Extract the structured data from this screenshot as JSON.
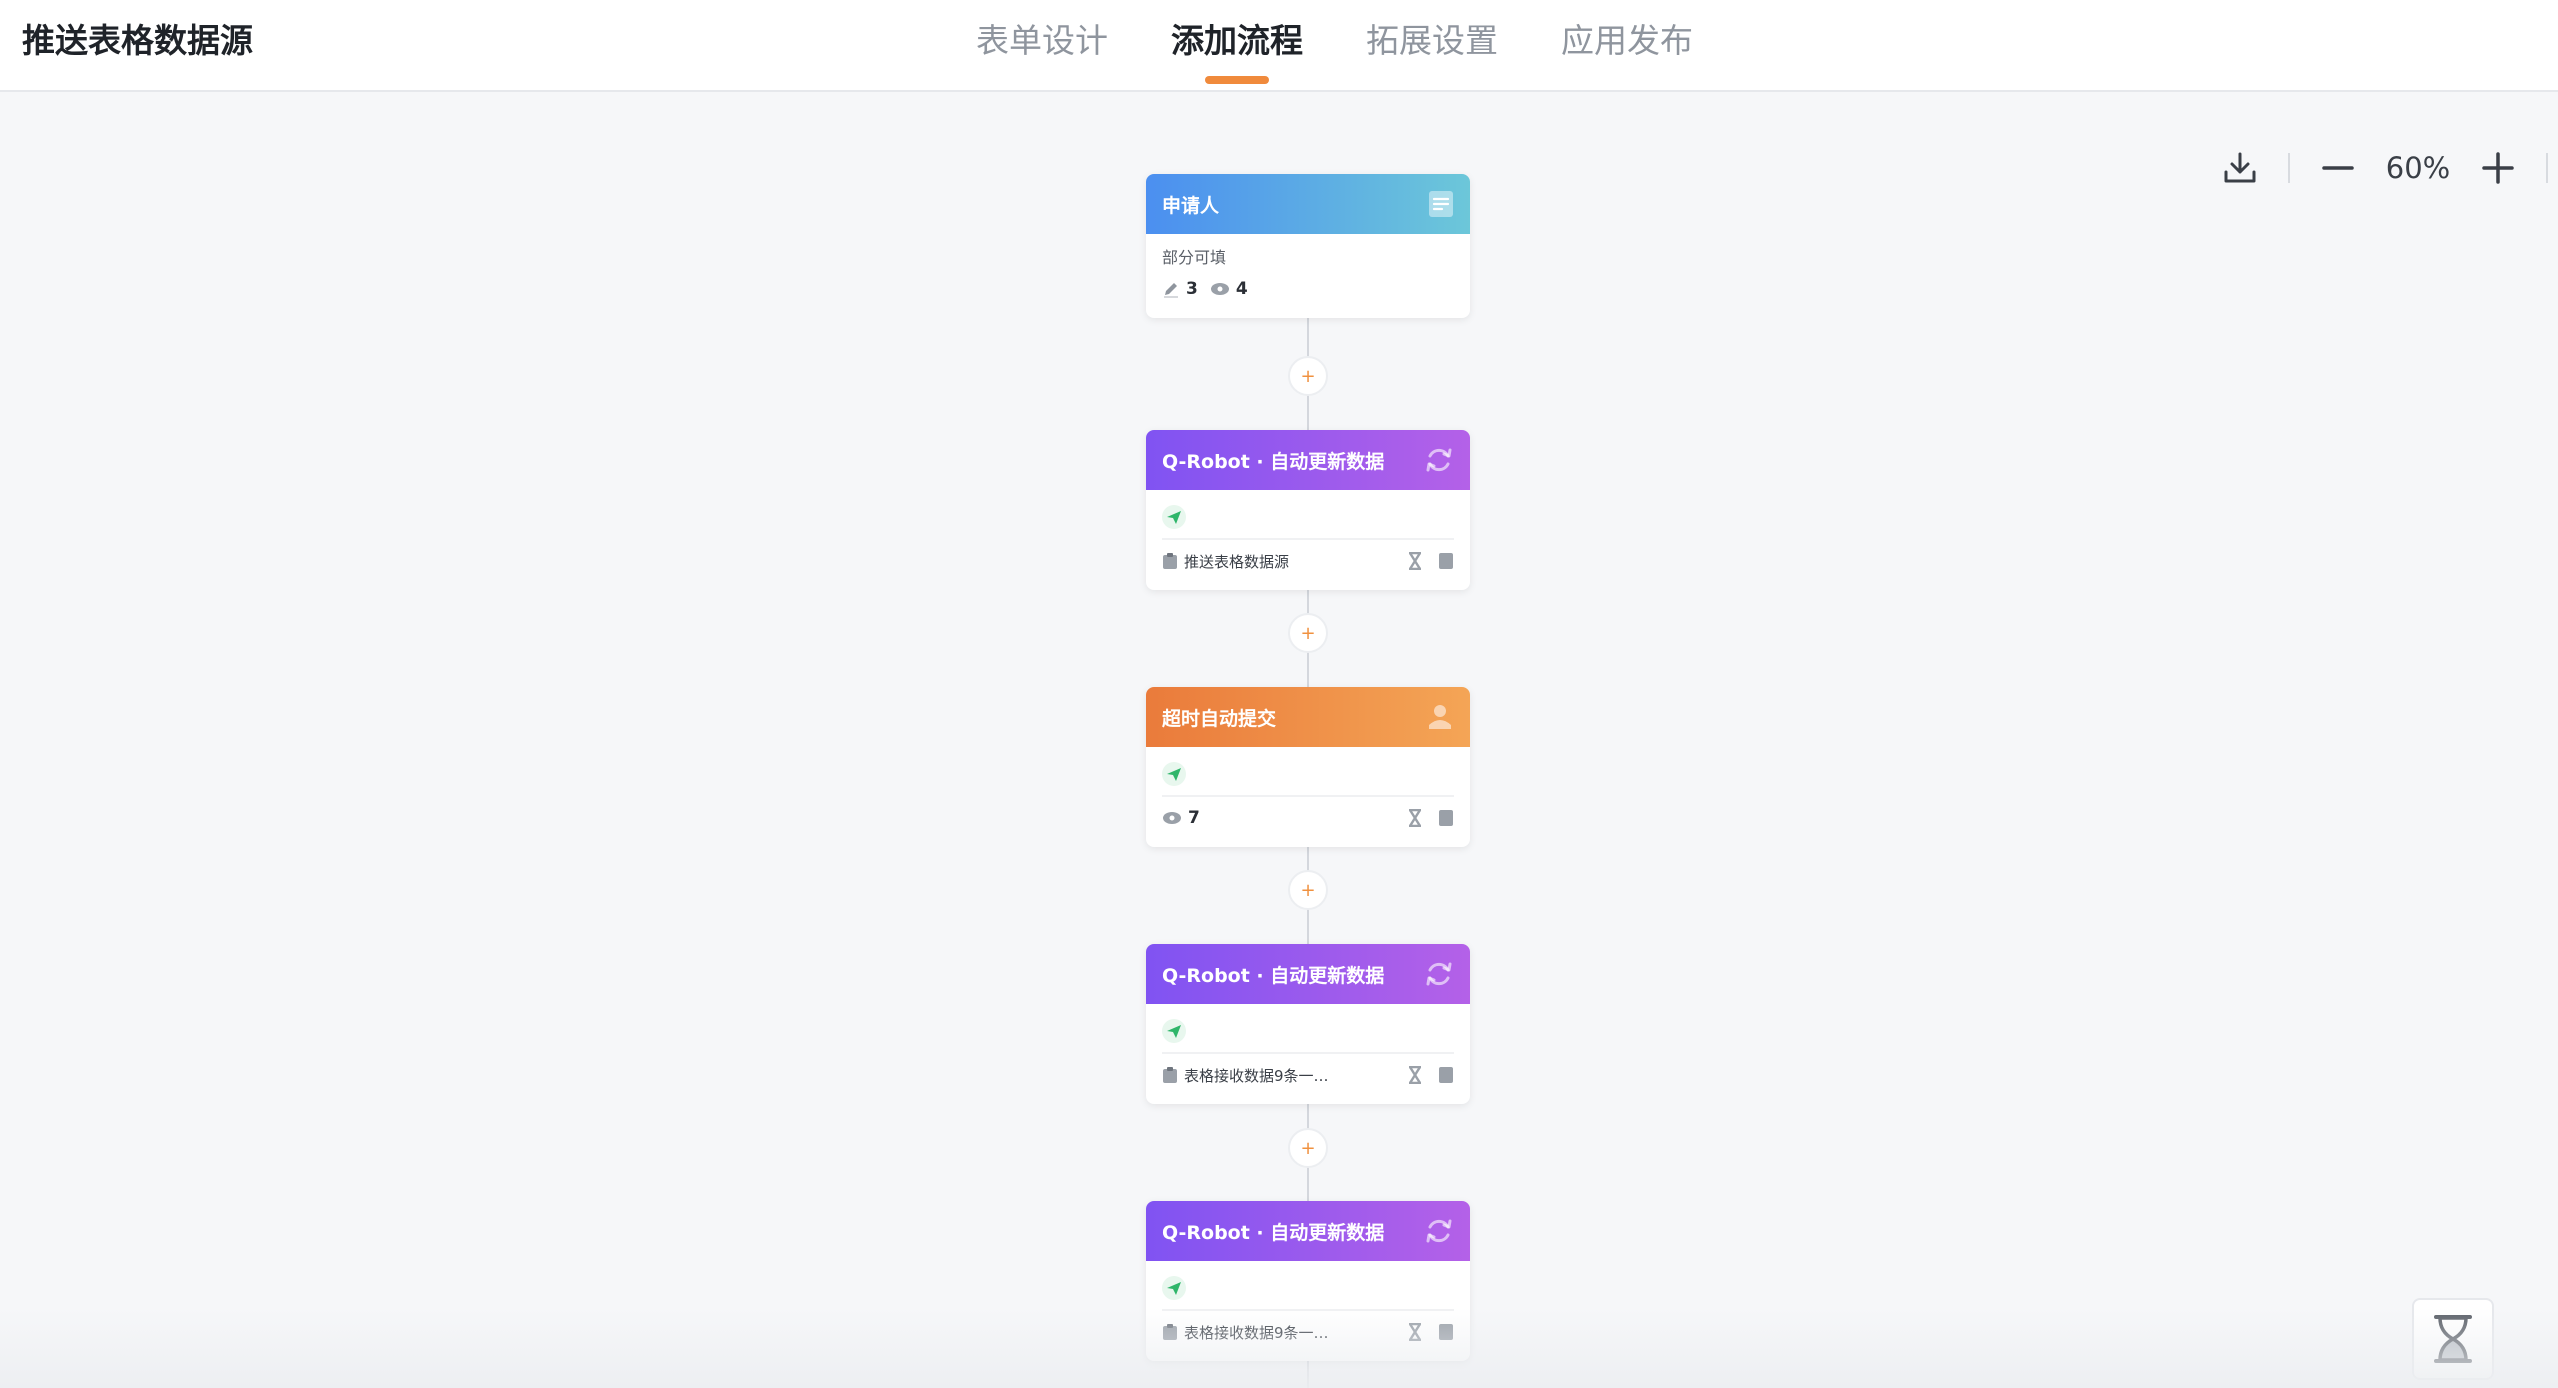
{
  "app": {
    "title": "推送表格数据源"
  },
  "tabs": [
    {
      "label": "表单设计"
    },
    {
      "label": "添加流程"
    },
    {
      "label": "拓展设置"
    },
    {
      "label": "应用发布"
    }
  ],
  "active_tab": "添加流程",
  "toolbar": {
    "zoom": "60%"
  },
  "accent_color": "#f08a3c",
  "nodes": [
    {
      "title": "申请人",
      "subtitle": "部分可填",
      "edit_count": "3",
      "view_count": "4",
      "icon": "form-icon"
    },
    {
      "title": "Q-Robot · 自动更新数据",
      "data_source": "推送表格数据源",
      "icon": "sync-icon"
    },
    {
      "title": "超时自动提交",
      "view_count": "7",
      "icon": "user-stamp-icon"
    },
    {
      "title": "Q-Robot · 自动更新数据",
      "data_source": "表格接收数据9条一…",
      "icon": "sync-icon"
    },
    {
      "title": "Q-Robot · 自动更新数据",
      "data_source": "表格接收数据9条一…",
      "icon": "sync-icon"
    }
  ],
  "add_button": {
    "label": "+"
  }
}
